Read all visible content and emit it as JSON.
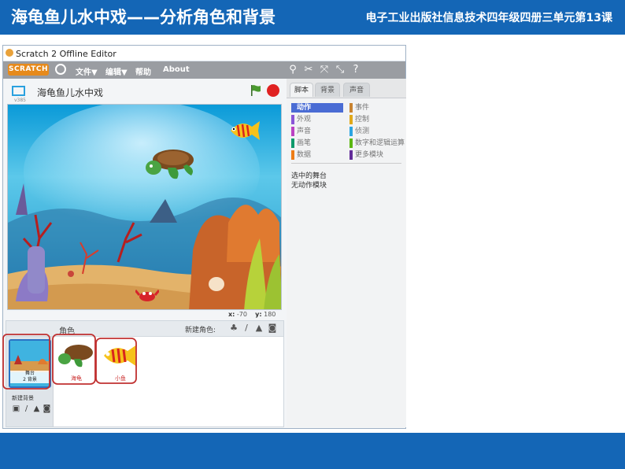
{
  "slide": {
    "lesson_title": "海龟鱼儿水中戏——分析角色和背景",
    "course_info": "电子工业出版社信息技术四年级四册三单元第13课"
  },
  "window": {
    "title": "Scratch 2 Offline Editor",
    "menu": {
      "logo": "SCRATCH",
      "file": "文件▼",
      "edit": "编辑▼",
      "help": "帮助",
      "about": "About"
    },
    "toolbar_icons": [
      "duplicate-icon",
      "cut-icon",
      "grow-icon",
      "shrink-icon",
      "block-help-icon"
    ]
  },
  "stage": {
    "project_name": "海龟鱼儿水中戏",
    "version_label": "v385",
    "x_label": "x:",
    "x_value": "-70",
    "y_label": "y:",
    "y_value": "180"
  },
  "sprites_panel": {
    "header_label": "角色",
    "new_sprite_label": "新建角色:",
    "stage_label_line1": "舞台",
    "stage_label_line2": "2 背景",
    "new_backdrop_label": "新建背景",
    "sprites": [
      {
        "name": "海龟"
      },
      {
        "name": "小鱼"
      }
    ]
  },
  "tabs": [
    "脚本",
    "背景",
    "声音"
  ],
  "categories": [
    {
      "label": "动作",
      "color": "#4a6cd4",
      "selected": true
    },
    {
      "label": "事件",
      "color": "#c88330"
    },
    {
      "label": "外观",
      "color": "#8a55d7"
    },
    {
      "label": "控制",
      "color": "#e1a91a"
    },
    {
      "label": "声音",
      "color": "#bb42c3"
    },
    {
      "label": "侦测",
      "color": "#2ca5e2"
    },
    {
      "label": "画笔",
      "color": "#0e9a6c"
    },
    {
      "label": "数字和逻辑运算",
      "color": "#5cb712"
    },
    {
      "label": "数据",
      "color": "#ee7d16"
    },
    {
      "label": "更多模块",
      "color": "#632d99"
    }
  ],
  "palette_message": {
    "line1": "选中的舞台",
    "line2": "无动作模块"
  },
  "colors": {
    "banner": "#1466b6",
    "motion_selected": "#4a6cd4",
    "sprite_highlight": "#c03030",
    "stop_button": "#e02222"
  }
}
